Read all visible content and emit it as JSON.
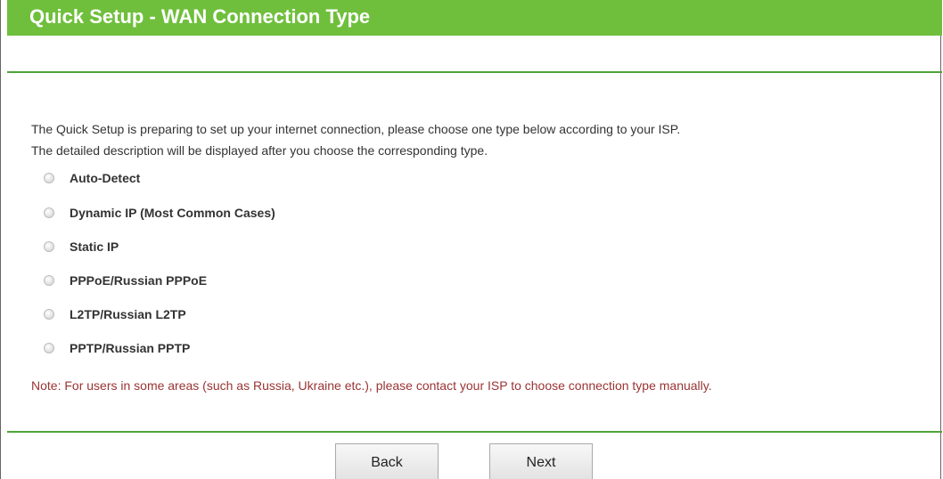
{
  "header": {
    "title": "Quick Setup - WAN Connection Type"
  },
  "intro": {
    "line1": "The Quick Setup is preparing to set up your internet connection, please choose one type below according to your ISP.",
    "line2": "The detailed description will be displayed after you choose the corresponding type."
  },
  "options": [
    {
      "label": "Auto-Detect",
      "selected": false
    },
    {
      "label": "Dynamic IP (Most Common Cases)",
      "selected": false
    },
    {
      "label": "Static IP",
      "selected": false
    },
    {
      "label": "PPPoE/Russian PPPoE",
      "selected": false
    },
    {
      "label": "L2TP/Russian L2TP",
      "selected": false
    },
    {
      "label": "PPTP/Russian PPTP",
      "selected": false
    }
  ],
  "note": "Note: For users in some areas (such as Russia, Ukraine etc.), please contact your ISP to choose connection type manually.",
  "buttons": {
    "back_label": "Back",
    "next_label": "Next"
  },
  "colors": {
    "header_bg": "#6fbf3c",
    "header_text": "#ffffff",
    "divider": "#4fa339",
    "note_text": "#993333"
  }
}
